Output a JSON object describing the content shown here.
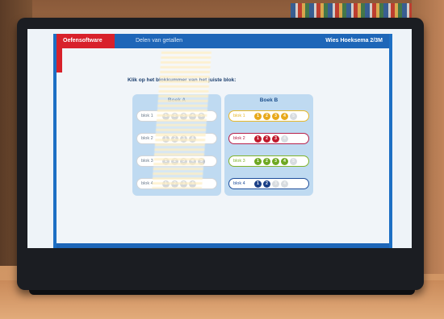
{
  "app": {
    "brand": "Oefensoftware",
    "subject": "Delen van getallen",
    "student": "Wies  Hoeksema 2/3M"
  },
  "question": "Klik op het blokkummer van het juiste blok:",
  "books": [
    {
      "title": "Boek A",
      "rows": [
        {
          "label": "blok 1",
          "border": "#d0d4d8",
          "dots": [
            {
              "n": "1",
              "c": "grey"
            },
            {
              "n": "2",
              "c": "grey"
            },
            {
              "n": "3",
              "c": "grey"
            },
            {
              "n": "4",
              "c": "grey"
            },
            {
              "n": "5",
              "c": "grey"
            }
          ]
        },
        {
          "label": "blok 2",
          "border": "#d0d4d8",
          "dots": [
            {
              "n": "1",
              "c": "grey"
            },
            {
              "n": "2",
              "c": "grey"
            },
            {
              "n": "3",
              "c": "grey"
            },
            {
              "n": "4",
              "c": "grey"
            }
          ]
        },
        {
          "label": "blok 3",
          "border": "#d0d4d8",
          "dots": [
            {
              "n": "1",
              "c": "grey"
            },
            {
              "n": "2",
              "c": "grey"
            },
            {
              "n": "3",
              "c": "grey"
            },
            {
              "n": "4",
              "c": "grey"
            },
            {
              "n": "5",
              "c": "grey"
            }
          ]
        },
        {
          "label": "blok 4",
          "border": "#d0d4d8",
          "dots": [
            {
              "n": "1",
              "c": "grey"
            },
            {
              "n": "2",
              "c": "grey"
            },
            {
              "n": "3",
              "c": "grey"
            },
            {
              "n": "4",
              "c": "grey"
            }
          ]
        }
      ]
    },
    {
      "title": "Boek B",
      "rows": [
        {
          "label": "blok 1",
          "border": "#e8b82a",
          "dots": [
            {
              "n": "1",
              "c": "#e8a91c"
            },
            {
              "n": "2",
              "c": "#e8a91c"
            },
            {
              "n": "3",
              "c": "#e8a91c"
            },
            {
              "n": "4",
              "c": "#e8a91c"
            },
            {
              "n": "5",
              "c": "light"
            }
          ]
        },
        {
          "label": "blok 2",
          "border": "#b8204a",
          "dots": [
            {
              "n": "1",
              "c": "#c01a2c"
            },
            {
              "n": "2",
              "c": "#c01a2c"
            },
            {
              "n": "3",
              "c": "#c01a2c"
            },
            {
              "n": "4",
              "c": "light"
            }
          ]
        },
        {
          "label": "blok 3",
          "border": "#7fb32a",
          "dots": [
            {
              "n": "1",
              "c": "#6fa822"
            },
            {
              "n": "2",
              "c": "#6fa822"
            },
            {
              "n": "3",
              "c": "#6fa822"
            },
            {
              "n": "4",
              "c": "#6fa822"
            },
            {
              "n": "5",
              "c": "light"
            }
          ]
        },
        {
          "label": "blok 4",
          "border": "#1f4e9a",
          "dots": [
            {
              "n": "1",
              "c": "#1a3f86"
            },
            {
              "n": "2",
              "c": "#1a3f86"
            },
            {
              "n": "3",
              "c": "light"
            },
            {
              "n": "4",
              "c": "light"
            }
          ]
        }
      ]
    }
  ]
}
